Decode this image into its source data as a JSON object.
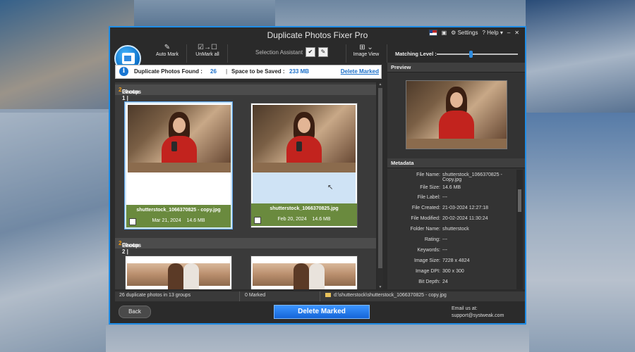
{
  "window": {
    "title": "Duplicate Photos Fixer Pro"
  },
  "top_right": {
    "settings": "Settings",
    "help": "? Help ▾"
  },
  "toolbar": {
    "auto_mark": "Auto Mark",
    "unmark_all": "UnMark all",
    "selection_assistant": "Selection Assistant",
    "image_view": "Image View",
    "matching_level_label": "Matching Level :",
    "matching_level": 0.42
  },
  "info": {
    "found_label": "Duplicate Photos Found :",
    "found_value": "26",
    "space_label": "Space to be Saved :",
    "space_value": "233 MB",
    "delete_link": "Delete Marked"
  },
  "groups": [
    {
      "header_prefix": "Group 1 |",
      "count": "2",
      "suffix": "Photos",
      "items": [
        {
          "filename": "shutterstock_1066370825 - copy.jpg",
          "date": "Mar 21, 2024",
          "size": "14.6 MB"
        },
        {
          "filename": "shutterstock_1066370825.jpg",
          "date": "Feb 20, 2024",
          "size": "14.6 MB"
        }
      ]
    },
    {
      "header_prefix": "Group 2 |",
      "count": "2",
      "suffix": "Photos"
    }
  ],
  "right_panel": {
    "preview_title": "Preview",
    "metadata_title": "Metadata",
    "metadata": [
      {
        "key": "File Name:",
        "value": "shutterstock_1066370825 - Copy.jpg"
      },
      {
        "key": "File Size:",
        "value": "14.6 MB"
      },
      {
        "key": "File Label:",
        "value": "---"
      },
      {
        "key": "File Created:",
        "value": "21-03-2024 12:27:18"
      },
      {
        "key": "File Modified:",
        "value": "20-02-2024 11:30:24"
      },
      {
        "key": "Folder Name:",
        "value": "shutterstock"
      },
      {
        "key": "Rating:",
        "value": "---"
      },
      {
        "key": "Keywords:",
        "value": "---"
      },
      {
        "key": "Image Size:",
        "value": "7228 x 4824"
      },
      {
        "key": "Image DPI:",
        "value": "300 x 300"
      },
      {
        "key": "Bit Depth:",
        "value": "24"
      }
    ]
  },
  "status": {
    "summary": "26 duplicate photos in 13 groups",
    "marked": "0 Marked",
    "path": "d:\\shutterstock\\shutterstock_1066370825 - copy.jpg"
  },
  "bottom": {
    "back": "Back",
    "delete": "Delete Marked",
    "email_label": "Email us at:",
    "email": "support@systweak.com"
  },
  "colors": {
    "accent": "#1f8de6",
    "count": "#f39c12",
    "caption_bg": "#6a8a3e"
  }
}
